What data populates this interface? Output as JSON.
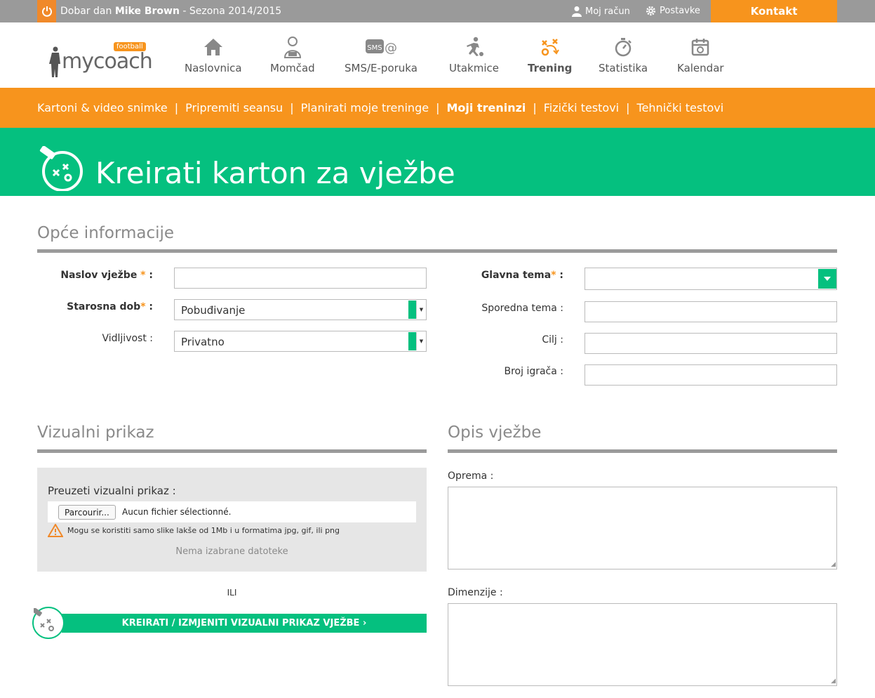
{
  "topbar": {
    "greeting_prefix": "Dobar dan",
    "user": "Mike Brown",
    "season": " - Sezona 2014/2015",
    "account": "Moj račun",
    "settings": "Postavke",
    "contact": "Kontakt",
    "accent": "#f7941d"
  },
  "logo": {
    "word": "mycoach",
    "badge": "football"
  },
  "nav": [
    {
      "label": "Naslovnica",
      "icon": "home-icon"
    },
    {
      "label": "Momčad",
      "icon": "team-icon"
    },
    {
      "label": "SMS/E-poruka",
      "icon": "sms-email-icon"
    },
    {
      "label": "Utakmice",
      "icon": "match-icon"
    },
    {
      "label": "Trening",
      "icon": "training-icon",
      "active": true
    },
    {
      "label": "Statistika",
      "icon": "stopwatch-icon"
    },
    {
      "label": "Kalendar",
      "icon": "calendar-icon"
    }
  ],
  "subnav": [
    {
      "label": "Kartoni & video snimke"
    },
    {
      "label": "Pripremiti seansu"
    },
    {
      "label": "Planirati moje treninge"
    },
    {
      "label": "Moji treninzi",
      "active": true
    },
    {
      "label": "Fizički testovi"
    },
    {
      "label": "Tehnički testovi"
    }
  ],
  "banner": {
    "title": "Kreirati karton za vježbe",
    "color": "#05c07f"
  },
  "general": {
    "title": "Opće informacije",
    "title_label": "Naslov vježbe",
    "title_value": "",
    "age_label": "Starosna dob",
    "age_value": "Pobuđivanje",
    "visibility_label": "Vidljivost :",
    "visibility_value": "Privatno",
    "main_theme_label": "Glavna tema",
    "main_theme_value": "",
    "secondary_theme_label": "Sporedna tema :",
    "goal_label": "Cilj :",
    "players_label": "Broj igrača :",
    "colon": " :",
    "req": "*"
  },
  "visual": {
    "title": "Vizualni prikaz",
    "upload_label": "Preuzeti vizualni prikaz :",
    "browse_button": "Parcourir...",
    "no_file": "Aucun fichier sélectionné.",
    "warning": "Mogu se koristiti samo slike lakše od 1Mb i u formatima jpg, gif, ili png",
    "no_file_selected": "Nema izabrane datoteke",
    "or": "ILI",
    "create_button": "KREIRATI / IZMJENITI VIZUALNI PRIKAZ VJEŽBE ›"
  },
  "description": {
    "title": "Opis vježbe",
    "equipment_label": "Oprema :",
    "dimensions_label": "Dimenzije :"
  }
}
